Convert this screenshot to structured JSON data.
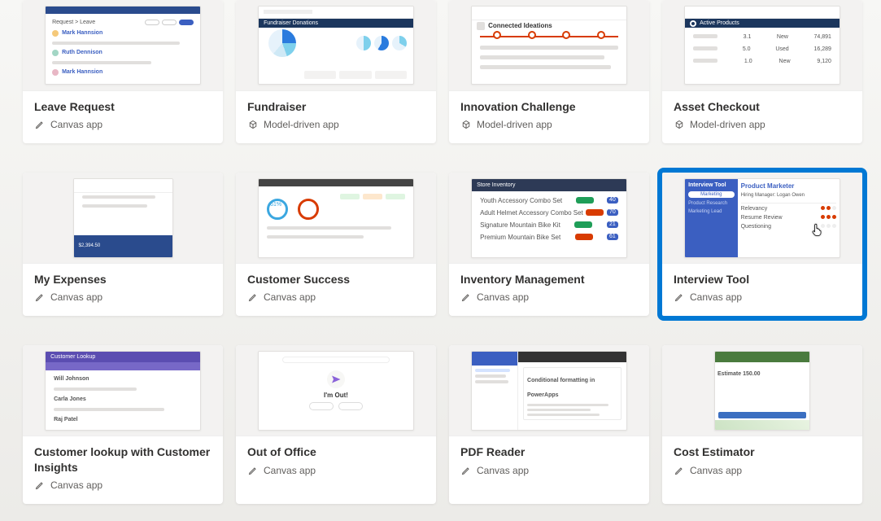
{
  "app_types": {
    "canvas": "Canvas app",
    "model": "Model-driven app"
  },
  "cards": [
    {
      "title": "Leave Request",
      "type": "canvas"
    },
    {
      "title": "Fundraiser",
      "type": "model"
    },
    {
      "title": "Innovation Challenge",
      "type": "model"
    },
    {
      "title": "Asset Checkout",
      "type": "model"
    },
    {
      "title": "My Expenses",
      "type": "canvas"
    },
    {
      "title": "Customer Success",
      "type": "canvas"
    },
    {
      "title": "Inventory Management",
      "type": "canvas"
    },
    {
      "title": "Interview Tool",
      "type": "canvas",
      "highlighted": true
    },
    {
      "title": "Customer lookup with Customer Insights",
      "type": "canvas"
    },
    {
      "title": "Out of Office",
      "type": "canvas"
    },
    {
      "title": "PDF Reader",
      "type": "canvas"
    },
    {
      "title": "Cost Estimator",
      "type": "canvas"
    }
  ],
  "thumbs": {
    "fundraiser_title": "Fundraiser Donations",
    "innovation_title": "Connected Ideations",
    "asset_title": "Active Products",
    "inventory_title": "Store Inventory",
    "inventory_rows": [
      {
        "label": "Youth Accessory Combo Set",
        "value": "40"
      },
      {
        "label": "Adult Helmet Accessory Combo Set",
        "value": "70"
      },
      {
        "label": "Signature Mountain Bike Kit",
        "value": "21"
      },
      {
        "label": "Premium Mountain Bike Set",
        "value": "61"
      }
    ],
    "interview": {
      "side_title": "Interview Tool",
      "tab1": "Marketing",
      "right_title": "Product Marketer",
      "right_sub": "Hiring Manager: Logan Owen",
      "row1": "Relevancy",
      "row2": "Resume Review",
      "row3": "Questioning"
    },
    "ooo": {
      "title": "I'm Out!"
    },
    "pdf": {
      "title": "Conditional formatting in PowerApps"
    },
    "cost": {
      "title": "Estimate 150.00"
    },
    "customer_lookup": {
      "title": "Customer Lookup"
    }
  }
}
